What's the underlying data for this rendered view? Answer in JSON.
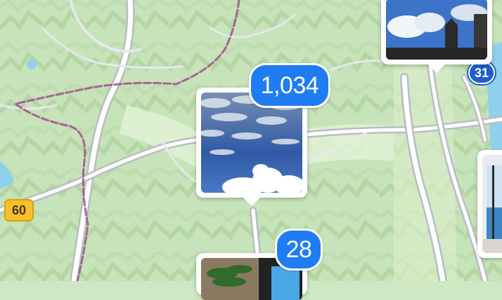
{
  "map": {
    "route_shields": [
      {
        "label": "60",
        "color": "#f6c12d"
      },
      {
        "label": "31",
        "color": "#1f5fcf"
      }
    ],
    "pins": [
      {
        "photo": "clouds-blue-sky",
        "count": "1,034"
      },
      {
        "photo": "castle-tower-blue-sky",
        "count": ""
      },
      {
        "photo": "palm-plant-room",
        "count": "28"
      },
      {
        "photo": "sea-window-view",
        "count": ""
      }
    ]
  },
  "colors": {
    "land": "#cfe8c4",
    "road": "#ffffff",
    "road_casing": "#b9bcc4",
    "trail": "#a04c8c",
    "badge": "#1f7cf2"
  }
}
